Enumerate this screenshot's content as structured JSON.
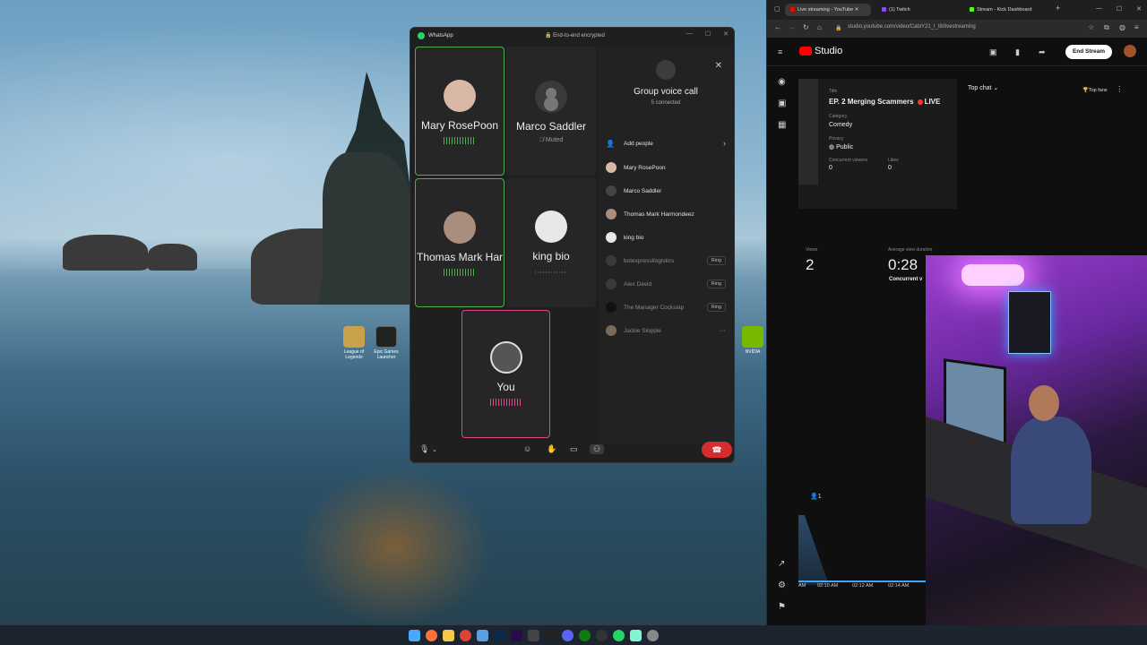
{
  "desktop": {
    "icons": [
      {
        "label": "League of Legends",
        "icon": "league-of-legends-icon",
        "color": "#c8a24a"
      },
      {
        "label": "Epic Games Launcher",
        "icon": "epic-games-icon",
        "color": "#2a2a2a"
      },
      {
        "label": "NVIDIA",
        "icon": "nvidia-icon",
        "color": "#76b900"
      }
    ]
  },
  "whatsapp": {
    "app_name": "WhatsApp",
    "encryption": "End-to-end encrypted",
    "tiles": [
      {
        "name": "Mary RosePoon",
        "status": ""
      },
      {
        "name": "Marco Saddler",
        "status": "Muted"
      },
      {
        "name": "Thomas Mark Har",
        "status": ""
      },
      {
        "name": "king bio",
        "status": ""
      },
      {
        "name": "You",
        "status": ""
      }
    ],
    "panel": {
      "title": "Group voice call",
      "subtitle": "5 connected",
      "add_people": "Add people",
      "participants": [
        {
          "name": "Mary RosePoon",
          "action": ""
        },
        {
          "name": "Marco Saddler",
          "action": ""
        },
        {
          "name": "Thomas Mark Harmondeez",
          "action": ""
        },
        {
          "name": "king bio",
          "action": ""
        },
        {
          "name": "botexpressllogistics",
          "action": "Ring"
        },
        {
          "name": "Alex David",
          "action": "Ring"
        },
        {
          "name": "The Manager Cockslap",
          "action": "Ring"
        },
        {
          "name": "Jackie Slopple",
          "action": "···"
        }
      ]
    },
    "accent_green": "#4caf50",
    "accent_pink": "#e0468a",
    "end_color": "#d62e2e"
  },
  "browser": {
    "tabs": [
      {
        "label": "Live streaming - YouTube",
        "color": "#ff0000"
      },
      {
        "label": "(1) Twitch",
        "color": "#9146ff"
      },
      {
        "label": "Stream - Kick Dashboard",
        "color": "#53fc18"
      }
    ],
    "new_tab": "+",
    "url": "studio.youtube.com/video/CabiY21_l_t8/livestreaming",
    "studio_label": "Studio",
    "end_stream": "End Stream",
    "stream": {
      "title_label": "Title",
      "title": "EP. 2 Merging Scammers",
      "live_badge": "LIVE",
      "category_label": "Category",
      "category": "Comedy",
      "privacy_label": "Privacy",
      "privacy": "Public",
      "concurrent_label": "Concurrent viewers",
      "concurrent": "0",
      "likes_label": "Likes",
      "likes": "0"
    },
    "chat": {
      "mode": "Top chat",
      "top_fans": "Top fans"
    },
    "analytics": {
      "views_label": "Views",
      "views": "2",
      "duration_label": "Average view duration",
      "duration": "0:28",
      "concurrent_tab": "Concurrent v",
      "viewers_now": "1",
      "x_labels": [
        "AM",
        "02:10 AM",
        "02:12 AM",
        "02:14 AM"
      ]
    }
  }
}
